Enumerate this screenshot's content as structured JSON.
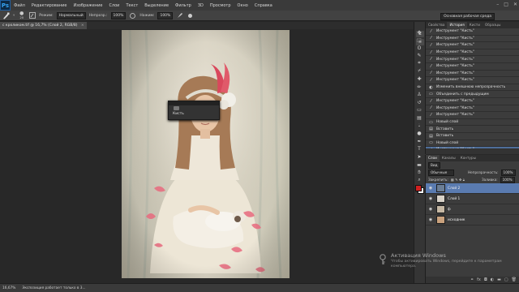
{
  "app": {
    "logo": "Ps"
  },
  "menu": [
    "Файл",
    "Редактирование",
    "Изображение",
    "Слои",
    "Текст",
    "Выделение",
    "Фильтр",
    "3D",
    "Просмотр",
    "Окно",
    "Справка"
  ],
  "window_controls": [
    "–",
    "□",
    "✕"
  ],
  "options": {
    "brush_size": "20",
    "mode_label": "Режим:",
    "mode_value": "Нормальный",
    "opacity_label": "Непрозр.:",
    "opacity_value": "100%",
    "flow_label": "Нажим:",
    "flow_value": "100%",
    "workspace": "Основная рабочая среда"
  },
  "document": {
    "tab_title": "с кроликом.tif @ 16,7% (Слой 2, RGB/8)",
    "tab_close": "×"
  },
  "brush_tooltip": {
    "label": "Кисть"
  },
  "history": {
    "tabs": [
      "Свойства",
      "История",
      "Кисти",
      "Образцы"
    ],
    "active_tab": "История",
    "items": [
      {
        "icon": "brush-icon",
        "label": "Инструмент \"Кисть\""
      },
      {
        "icon": "brush-icon",
        "label": "Инструмент \"Кисть\""
      },
      {
        "icon": "brush-icon",
        "label": "Инструмент \"Кисть\""
      },
      {
        "icon": "brush-icon",
        "label": "Инструмент \"Кисть\""
      },
      {
        "icon": "brush-icon",
        "label": "Инструмент \"Кисть\""
      },
      {
        "icon": "brush-icon",
        "label": "Инструмент \"Кисть\""
      },
      {
        "icon": "brush-icon",
        "label": "Инструмент \"Кисть\""
      },
      {
        "icon": "brush-icon",
        "label": "Инструмент \"Кисть\""
      },
      {
        "icon": "adjust-icon",
        "label": "Изменить внешнюю непрозрачность"
      },
      {
        "icon": "layer-icon",
        "label": "Объединить с предыдущим"
      },
      {
        "icon": "brush-icon",
        "label": "Инструмент \"Кисть\""
      },
      {
        "icon": "brush-icon",
        "label": "Инструмент \"Кисть\""
      },
      {
        "icon": "brush-icon",
        "label": "Инструмент \"Кисть\""
      },
      {
        "icon": "layer-icon",
        "label": "Новый слой"
      },
      {
        "icon": "paste-icon",
        "label": "Вставить"
      },
      {
        "icon": "paste-icon",
        "label": "Вставить"
      },
      {
        "icon": "layer-icon",
        "label": "Новый слой"
      },
      {
        "icon": "brush-icon",
        "label": "Инструмент \"Кисть\""
      }
    ],
    "selected_index": 17
  },
  "layers": {
    "tabs": [
      "Слои",
      "Каналы",
      "Контуры"
    ],
    "active_tab": "Слои",
    "filter_label": "Вид",
    "blend_mode": "Обычные",
    "opacity_label": "Непрозрачность:",
    "opacity_value": "100%",
    "lock_label": "Закрепить:",
    "fill_label": "Заливка:",
    "fill_value": "100%",
    "items": [
      {
        "name": "Слой 2",
        "thumb_color": "#6b7e96",
        "selected": true
      },
      {
        "name": "Слой 1",
        "thumb_color": "#d8d2c8",
        "selected": false
      },
      {
        "name": "ф",
        "thumb_color": "#c6b8a4",
        "selected": false
      },
      {
        "name": "исходник",
        "thumb_color": "#caa27e",
        "selected": false
      }
    ],
    "footer_icons": [
      "link-icon",
      "fx-icon",
      "mask-icon",
      "adjustment-icon",
      "group-icon",
      "new-layer-icon",
      "trash-icon"
    ]
  },
  "status": {
    "zoom": "16,67%",
    "info": "Экспозиция работает только в 3..."
  },
  "activation": {
    "title": "Активация Windows",
    "body": "Чтобы активировать Windows, перейдите к параметрам компьютера."
  },
  "colors": {
    "accent": "#4e6e9a",
    "layer_selected": "#5a7bb0",
    "foreground_swatch": "#d02020",
    "background_swatch": "#ffffff"
  }
}
